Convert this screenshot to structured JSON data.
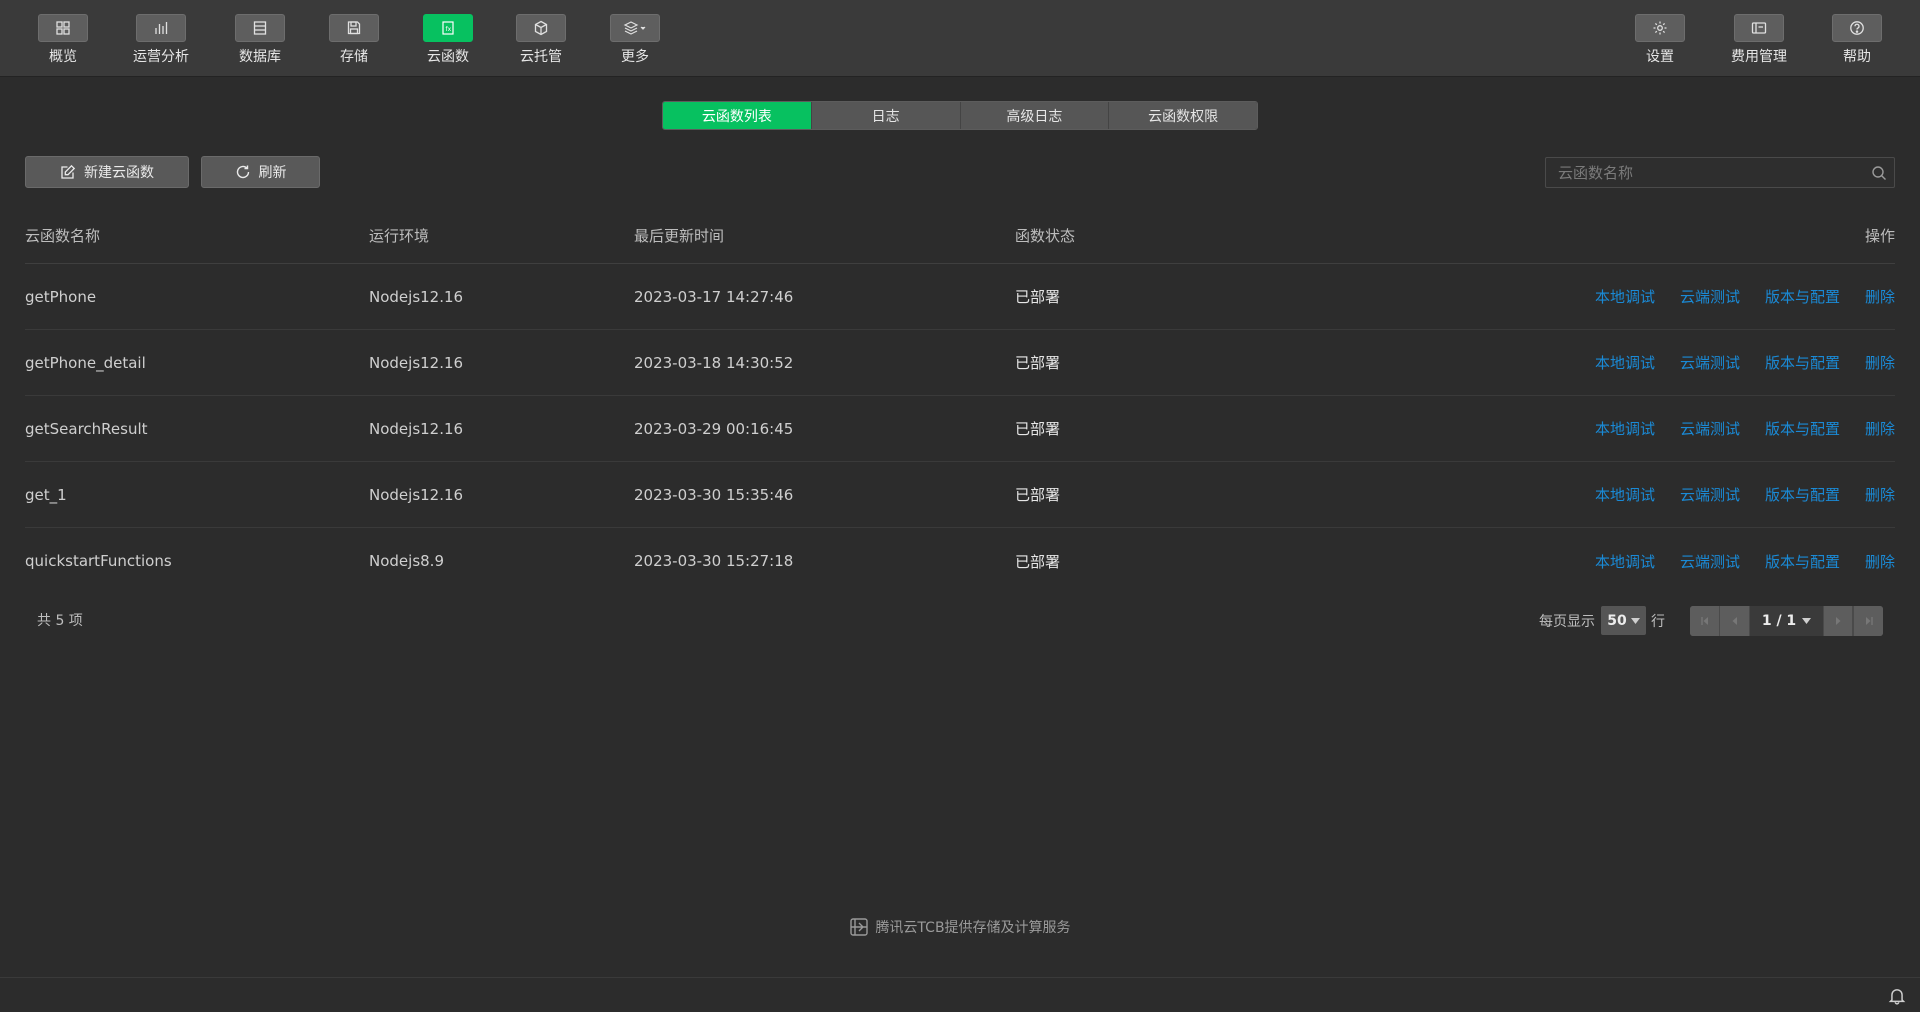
{
  "nav": {
    "left": [
      {
        "label": "概览",
        "icon": "grid-icon"
      },
      {
        "label": "运营分析",
        "icon": "bar-chart-icon"
      },
      {
        "label": "数据库",
        "icon": "database-icon"
      },
      {
        "label": "存储",
        "icon": "floppy-icon"
      },
      {
        "label": "云函数",
        "icon": "function-icon",
        "active": true
      },
      {
        "label": "云托管",
        "icon": "cube-icon"
      },
      {
        "label": "更多",
        "icon": "layers-icon"
      }
    ],
    "right": [
      {
        "label": "设置",
        "icon": "gear-icon"
      },
      {
        "label": "费用管理",
        "icon": "billing-icon"
      },
      {
        "label": "帮助",
        "icon": "help-icon"
      }
    ]
  },
  "tabs": [
    "云函数列表",
    "日志",
    "高级日志",
    "云函数权限"
  ],
  "active_tab": "云函数列表",
  "toolbar": {
    "new_label": "新建云函数",
    "refresh_label": "刷新",
    "search_placeholder": "云函数名称"
  },
  "table": {
    "headers": {
      "name": "云函数名称",
      "env": "运行环境",
      "time": "最后更新时间",
      "state": "函数状态",
      "ops": "操作"
    },
    "ops_labels": [
      "本地调试",
      "云端测试",
      "版本与配置",
      "删除"
    ],
    "rows": [
      {
        "name": "getPhone",
        "env": "Nodejs12.16",
        "time": "2023-03-17 14:27:46",
        "state": "已部署"
      },
      {
        "name": "getPhone_detail",
        "env": "Nodejs12.16",
        "time": "2023-03-18 14:30:52",
        "state": "已部署"
      },
      {
        "name": "getSearchResult",
        "env": "Nodejs12.16",
        "time": "2023-03-29 00:16:45",
        "state": "已部署"
      },
      {
        "name": "get_1",
        "env": "Nodejs12.16",
        "time": "2023-03-30 15:35:46",
        "state": "已部署"
      },
      {
        "name": "quickstartFunctions",
        "env": "Nodejs8.9",
        "time": "2023-03-30 15:27:18",
        "state": "已部署"
      }
    ]
  },
  "pagination": {
    "total": "共 5 项",
    "per_page_label": "每页显示",
    "per_page": "50",
    "per_page_unit": "行",
    "page": "1 / 1"
  },
  "footer": {
    "text": "腾讯云TCB提供存储及计算服务"
  },
  "colors": {
    "accent": "#07c160",
    "link": "#1a8ad6",
    "background": "#2c2c2c"
  }
}
